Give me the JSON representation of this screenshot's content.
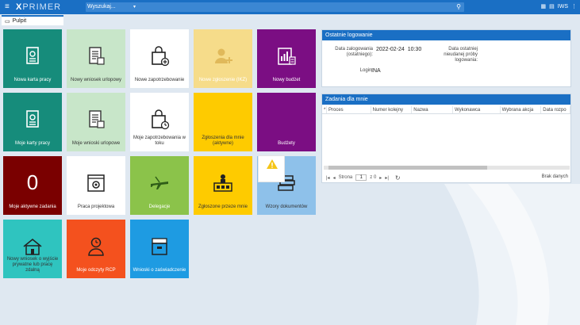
{
  "app": {
    "logo_x": "X",
    "logo_rest": "PRIMER"
  },
  "search": {
    "placeholder": "Wyszukaj..."
  },
  "header_right": {
    "user_label": "IWS"
  },
  "tabs": [
    {
      "label": "Pulpit"
    }
  ],
  "tiles": [
    {
      "label": "Nowa karta pracy",
      "color": "#168c7b",
      "icon": "document-icon"
    },
    {
      "label": "Nowy wniosek urlopowy",
      "color": "#c8e6c9",
      "icon": "form-document-icon"
    },
    {
      "label": "Nowe zapotrzebowanie",
      "color": "#ffffff",
      "icon": "shopping-bag-add-icon"
    },
    {
      "label": "Nowe zgłoszenie (IKZ)",
      "color": "#f6dc8a",
      "icon": "user-add-icon"
    },
    {
      "label": "Nowy budżet",
      "color": "#7b0e83",
      "icon": "budget-calculator-icon"
    },
    {
      "label": "Moje karty pracy",
      "color": "#168c7b",
      "icon": "document-icon"
    },
    {
      "label": "Moje wnioski urlopowe",
      "color": "#c8e6c9",
      "icon": "form-document-icon"
    },
    {
      "label": "Moje zapotrzebowania w toku",
      "color": "#ffffff",
      "icon": "shopping-bag-clock-icon"
    },
    {
      "label": "Zgłoszenia dla mnie (aktywne)",
      "color": "#fecb00",
      "icon": ""
    },
    {
      "label": "Budżety",
      "color": "#7b0e83",
      "icon": ""
    },
    {
      "label": "Moje aktywne zadania",
      "color": "#7a0000",
      "icon": "",
      "count": "0"
    },
    {
      "label": "Praca projektowa",
      "color": "#ffffff",
      "icon": "gear-window-icon"
    },
    {
      "label": "Delegacje",
      "color": "#8bc34a",
      "icon": "airplane-icon"
    },
    {
      "label": "Zgłoszone przeze mnie",
      "color": "#fecb00",
      "icon": "user-desk-icon"
    },
    {
      "label": "Wzory dokumentów",
      "color": "#8ec1ea",
      "icon": "books-icon"
    },
    {
      "label": "Nowy wniosek o wyjście prywatne lub pracę zdalną",
      "color": "#2fc4bf",
      "icon": "house-icon"
    },
    {
      "label": "Moje odczyty RCP",
      "color": "#f4511e",
      "icon": "user-clock-icon"
    },
    {
      "label": "Wnioski o zaświadczenie",
      "color": "#1e9be2",
      "icon": "archive-box-icon"
    }
  ],
  "login_panel": {
    "title": "Ostatnie logowanie",
    "last_login_label": "Data zalogowania (ostatniego):",
    "last_login_value": "2022-02-24  10:30",
    "failed_label": "Data ostatniej nieudanej próby logowania:",
    "failed_value": "",
    "login_label": "Login:",
    "login_value": "INA"
  },
  "tasks_panel": {
    "title": "Zadania dla mnie",
    "columns": [
      "Proces",
      "Numer kolejny",
      "Nazwa",
      "Wykonawca",
      "Wybrana akcja",
      "Data rozpo"
    ],
    "page_label": "Strona",
    "page_value": "1",
    "page_of": "z 0",
    "no_data": "Brak danych"
  },
  "colors": {
    "accent": "#1a6fc4",
    "warning": "#f5c518"
  }
}
